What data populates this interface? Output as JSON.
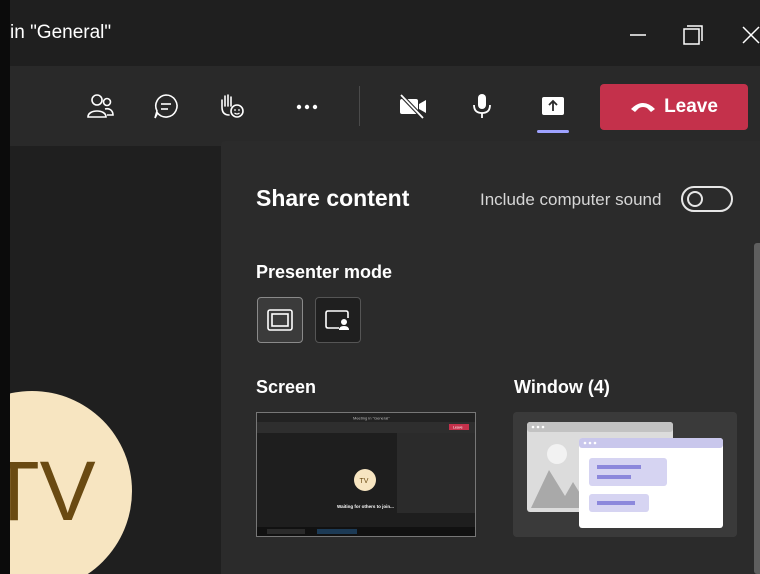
{
  "window": {
    "title": "in \"General\"",
    "minimize_icon": "minimize-icon",
    "maximize_icon": "maximize-icon",
    "close_icon": "close-icon"
  },
  "toolbar": {
    "items": [
      {
        "name": "people-button",
        "icon": "people-icon"
      },
      {
        "name": "chat-button",
        "icon": "chat-icon"
      },
      {
        "name": "raise-hand-button",
        "icon": "hand-icon"
      },
      {
        "name": "more-actions-button",
        "icon": "more-icon"
      },
      {
        "name": "camera-button",
        "icon": "camera-off-icon"
      },
      {
        "name": "mic-button",
        "icon": "microphone-icon"
      },
      {
        "name": "share-button",
        "icon": "share-icon"
      }
    ],
    "leave_label": "Leave",
    "leave_color": "#c4314b",
    "active_accent": "#9ea2ff"
  },
  "participant": {
    "initials": "TV",
    "avatar_bg": "#f7e5c1",
    "avatar_fg": "#6a4a12"
  },
  "share_panel": {
    "title": "Share content",
    "sound_label": "Include computer sound",
    "sound_on": false,
    "presenter_heading": "Presenter mode",
    "screen_heading": "Screen",
    "window_heading": "Window (4)",
    "thumb": {
      "title": "Meeting in \"General\"",
      "initials": "TV",
      "waiting": "Waiting for others to join...",
      "leave": "Leave"
    }
  }
}
